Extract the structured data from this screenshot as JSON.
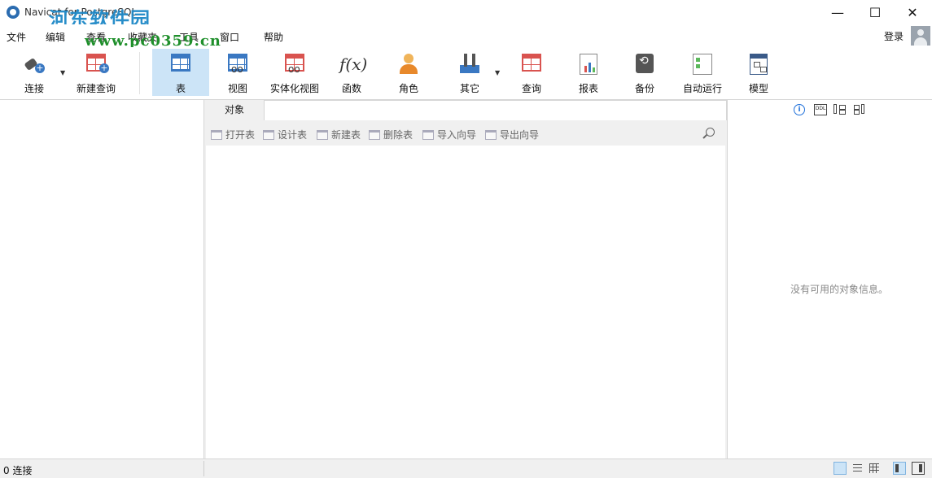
{
  "window": {
    "title": "Navicat for PostgreSQL",
    "watermark": "河东软件园",
    "watermark_url": "www.pc0359.cn",
    "controls": {
      "minimize": "—",
      "maximize": "☐",
      "close": "✕"
    }
  },
  "menu": [
    "文件",
    "编辑",
    "查看",
    "收藏夹",
    "工具",
    "窗口",
    "帮助"
  ],
  "account": {
    "login_label": "登录"
  },
  "toolbar": {
    "connect": "连接",
    "new_query": "新建查询",
    "items": [
      "表",
      "视图",
      "实体化视图",
      "函数",
      "角色",
      "其它",
      "查询",
      "报表",
      "备份",
      "自动运行",
      "模型"
    ],
    "active": "表",
    "fx_glyph": "f(x)",
    "dropdown_glyph": "▼"
  },
  "object_panel": {
    "tab_label": "对象",
    "tools": [
      "打开表",
      "设计表",
      "新建表",
      "删除表",
      "导入向导",
      "导出向导"
    ]
  },
  "info_panel": {
    "empty_message": "没有可用的对象信息。",
    "info_glyph": "i",
    "ddl_glyph": "DDL"
  },
  "status": {
    "connections": "0 连接"
  }
}
